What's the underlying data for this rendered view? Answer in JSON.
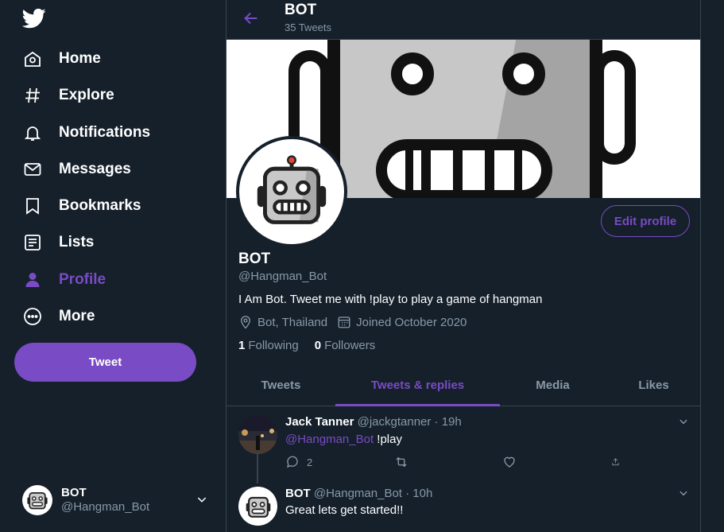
{
  "sidebar": {
    "items": [
      {
        "label": "Home",
        "icon": "home-icon"
      },
      {
        "label": "Explore",
        "icon": "hashtag-icon"
      },
      {
        "label": "Notifications",
        "icon": "bell-icon"
      },
      {
        "label": "Messages",
        "icon": "envelope-icon"
      },
      {
        "label": "Bookmarks",
        "icon": "bookmark-icon"
      },
      {
        "label": "Lists",
        "icon": "list-icon"
      },
      {
        "label": "Profile",
        "icon": "person-icon"
      },
      {
        "label": "More",
        "icon": "more-icon"
      }
    ],
    "active": "Profile",
    "tweet_label": "Tweet",
    "account": {
      "name": "BOT",
      "handle": "@Hangman_Bot"
    }
  },
  "header": {
    "title": "BOT",
    "subtitle": "35 Tweets"
  },
  "profile": {
    "edit_label": "Edit profile",
    "name": "BOT",
    "handle": "@Hangman_Bot",
    "bio": "I Am Bot. Tweet me with !play to play a game of hangman",
    "location": "Bot, Thailand",
    "joined": "Joined October 2020",
    "following_count": "1",
    "following_label": "Following",
    "followers_count": "0",
    "followers_label": "Followers"
  },
  "tabs": [
    {
      "label": "Tweets"
    },
    {
      "label": "Tweets & replies"
    },
    {
      "label": "Media"
    },
    {
      "label": "Likes"
    }
  ],
  "active_tab": "Tweets & replies",
  "timeline": [
    {
      "name": "Jack Tanner",
      "handle": "@jackgtanner · 19h",
      "mention": "@Hangman_Bot",
      "text": " !play",
      "reply_count": "2"
    },
    {
      "name": "BOT",
      "handle": "@Hangman_Bot · 10h",
      "text": "Great lets get started!!"
    }
  ],
  "colors": {
    "background": "#15202b",
    "accent": "#794bc4",
    "muted": "#8899a6",
    "border": "#38444d"
  }
}
